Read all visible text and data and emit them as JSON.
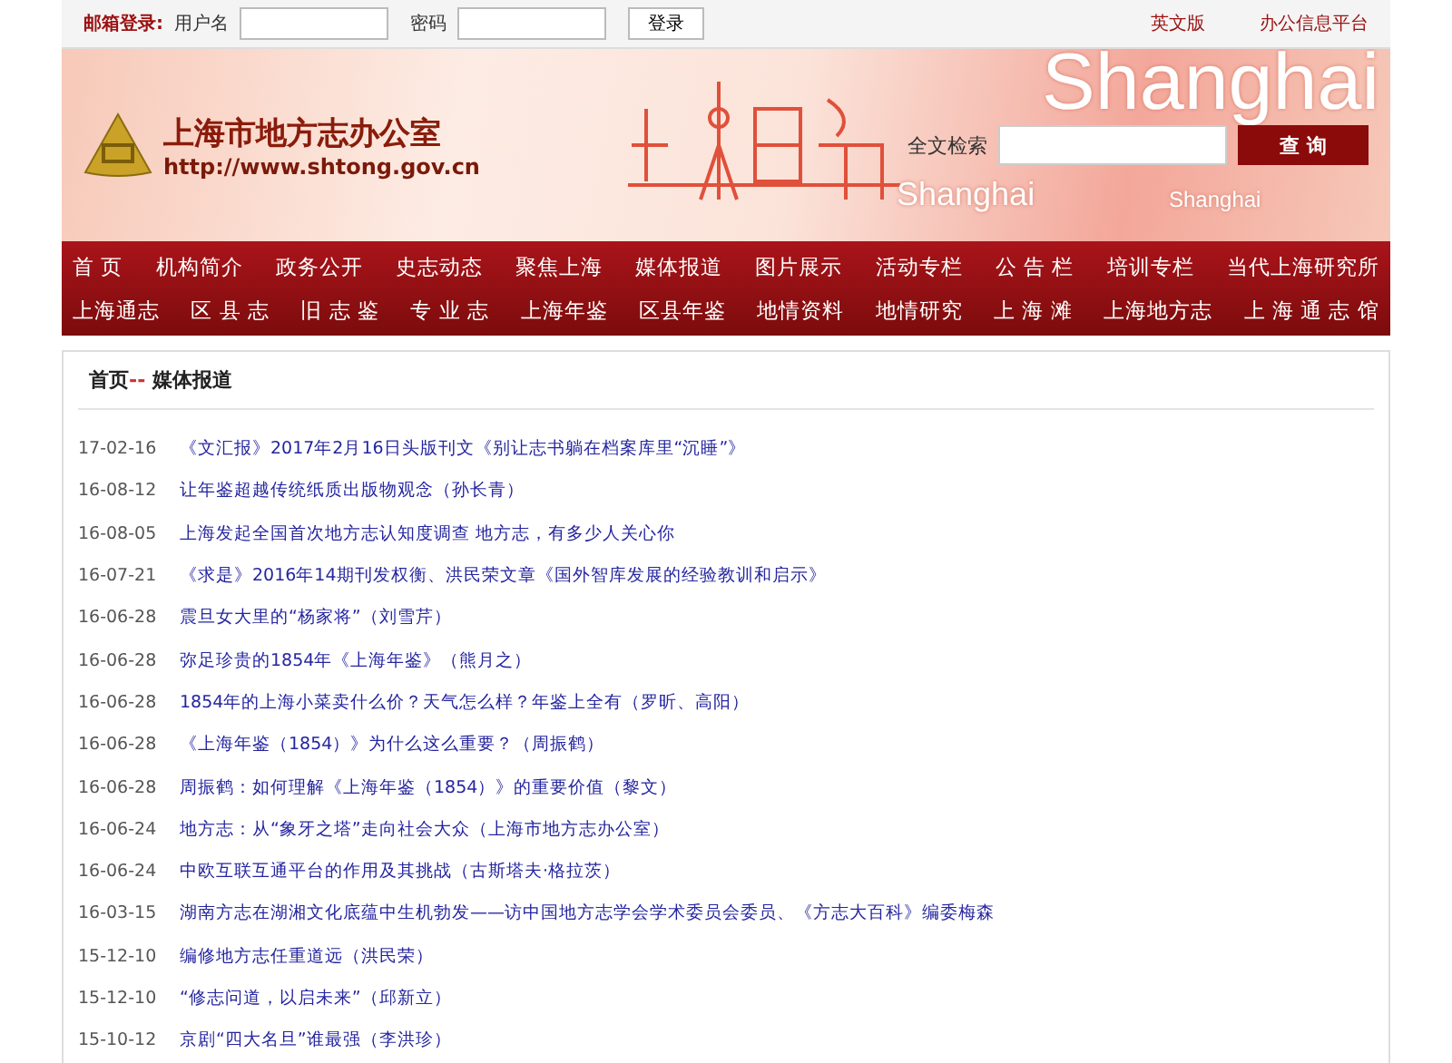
{
  "top_bar": {
    "login_label": "邮箱登录:",
    "username_label": "用户名",
    "password_label": "密码",
    "login_button": "登录",
    "links": [
      "英文版",
      "办公信息平台"
    ]
  },
  "banner": {
    "site_title": "上海市地方志办公室",
    "site_url": "http://www.shtong.gov.cn",
    "decor_words": [
      "Shanghai",
      "Shanghai",
      "Shanghai"
    ],
    "search_label": "全文检索",
    "search_button": "查 询"
  },
  "nav": [
    [
      "首 页",
      "机构简介",
      "政务公开",
      "史志动态",
      "聚焦上海",
      "媒体报道",
      "图片展示",
      "活动专栏",
      "公 告 栏",
      "培训专栏",
      "当代上海研究所"
    ],
    [
      "上海通志",
      "区 县 志",
      "旧 志 鉴",
      "专 业 志",
      "上海年鉴",
      "区县年鉴",
      "地情资料",
      "地情研究",
      "上 海 滩",
      "上海地方志",
      "上 海 通 志 馆"
    ]
  ],
  "breadcrumb": {
    "home": "首页",
    "separator": "--",
    "current": "媒体报道"
  },
  "articles": [
    {
      "date": "17-02-16",
      "title": "《文汇报》2017年2月16日头版刊文《别让志书躺在档案库里“沉睡”》"
    },
    {
      "date": "16-08-12",
      "title": "让年鉴超越传统纸质出版物观念（孙长青）"
    },
    {
      "date": "16-08-05",
      "title": "上海发起全国首次地方志认知度调查 地方志，有多少人关心你"
    },
    {
      "date": "16-07-21",
      "title": "《求是》2016年14期刊发权衡、洪民荣文章《国外智库发展的经验教训和启示》"
    },
    {
      "date": "16-06-28",
      "title": "震旦女大里的“杨家将”（刘雪芹）"
    },
    {
      "date": "16-06-28",
      "title": "弥足珍贵的1854年《上海年鉴》（熊月之）"
    },
    {
      "date": "16-06-28",
      "title": "1854年的上海小菜卖什么价？天气怎么样？年鉴上全有（罗昕、高阳）"
    },
    {
      "date": "16-06-28",
      "title": "《上海年鉴（1854）》为什么这么重要？（周振鹤）"
    },
    {
      "date": "16-06-28",
      "title": "周振鹤：如何理解《上海年鉴（1854）》的重要价值（黎文）"
    },
    {
      "date": "16-06-24",
      "title": "地方志：从“象牙之塔”走向社会大众（上海市地方志办公室）"
    },
    {
      "date": "16-06-24",
      "title": "中欧互联互通平台的作用及其挑战（古斯塔夫·格拉茨）"
    },
    {
      "date": "16-03-15",
      "title": "湖南方志在湖湘文化底蕴中生机勃发——访中国地方志学会学术委员会委员、《方志大百科》编委梅森"
    },
    {
      "date": "15-12-10",
      "title": "编修地方志任重道远（洪民荣）"
    },
    {
      "date": "15-12-10",
      "title": "“修志问道，以启未来”（邱新立）"
    },
    {
      "date": "15-10-12",
      "title": "京剧“四大名旦”谁最强（李洪珍）"
    }
  ]
}
